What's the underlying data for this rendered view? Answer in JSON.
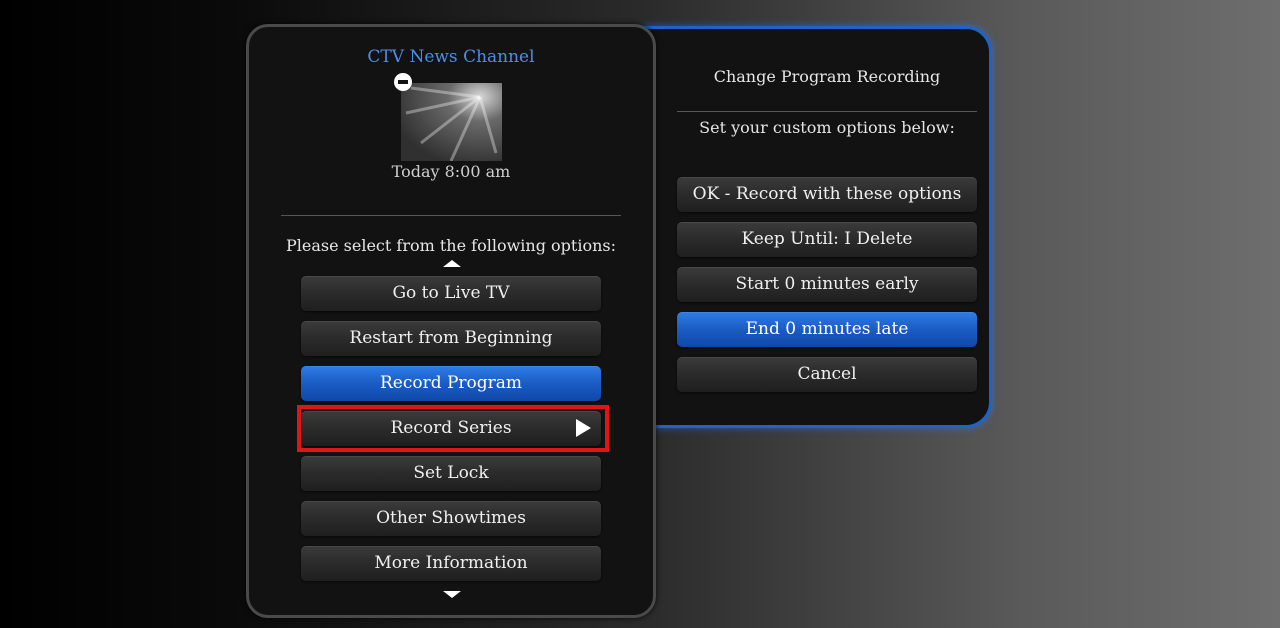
{
  "recording_panel": {
    "title": "Change Program Recording",
    "subtitle": "Set your custom options below:",
    "buttons": [
      {
        "label": "OK - Record with these options",
        "active": false
      },
      {
        "label": "Keep Until: I Delete",
        "active": false
      },
      {
        "label": "Start 0 minutes early",
        "active": false
      },
      {
        "label": "End 0 minutes late",
        "active": true
      },
      {
        "label": "Cancel",
        "active": false
      }
    ]
  },
  "program_panel": {
    "channel_name": "CTV News Channel",
    "airtime": "Today 8:00 am",
    "prompt": "Please select from the following options:",
    "options": [
      {
        "label": "Go to Live TV",
        "active": false
      },
      {
        "label": "Restart from Beginning",
        "active": false
      },
      {
        "label": "Record Program",
        "active": true
      },
      {
        "label": "Record Series",
        "active": false,
        "highlighted": true
      },
      {
        "label": "Set Lock",
        "active": false
      },
      {
        "label": "Other Showtimes",
        "active": false
      },
      {
        "label": "More Information",
        "active": false
      }
    ],
    "icons": {
      "minus": "minus-circle-icon",
      "submenu": "play-arrow-icon",
      "scroll_up": "arrow-up-icon",
      "scroll_down": "arrow-down-icon"
    }
  },
  "colors": {
    "accent_blue": "#1a5cc4",
    "channel_text": "#4d8fe8",
    "highlight_red": "#e01616",
    "panel_bg": "#121212"
  }
}
